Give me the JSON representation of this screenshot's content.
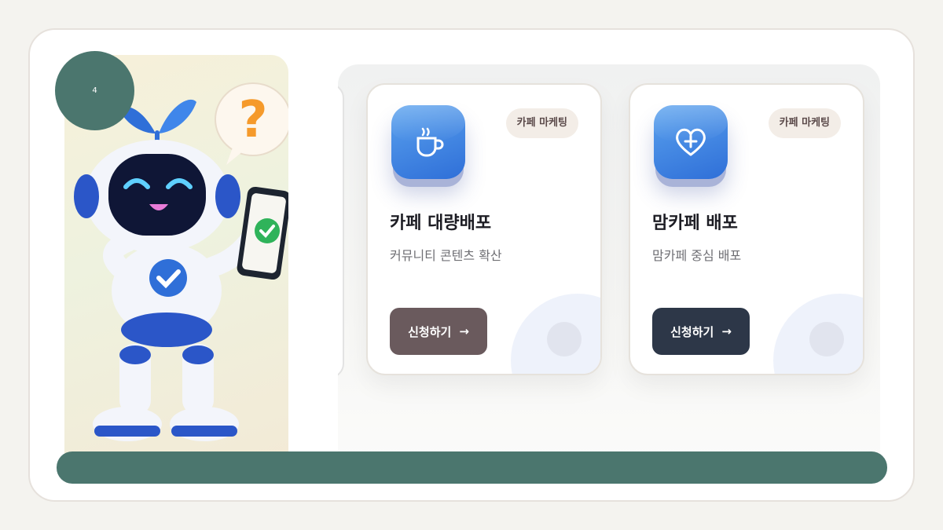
{
  "page": {
    "number": "4"
  },
  "colors": {
    "accent": "#4b766e",
    "button_primary": "#6a5a5d",
    "button_secondary": "#2d3748",
    "tag_bg": "#f3ede7"
  },
  "mascot": {
    "icon": "robot-mascot-illustration"
  },
  "cards": [
    {
      "tag": "카페 마케팅",
      "icon": "coffee-cup-icon",
      "title": "카페 대량배포",
      "description": "커뮤니티 콘텐츠 확산",
      "button_label": "신청하기",
      "button_arrow": "→"
    },
    {
      "tag": "카페 마케팅",
      "icon": "heart-plus-icon",
      "title": "맘카페 배포",
      "description": "맘카페 중심 배포",
      "button_label": "신청하기",
      "button_arrow": "→"
    }
  ]
}
